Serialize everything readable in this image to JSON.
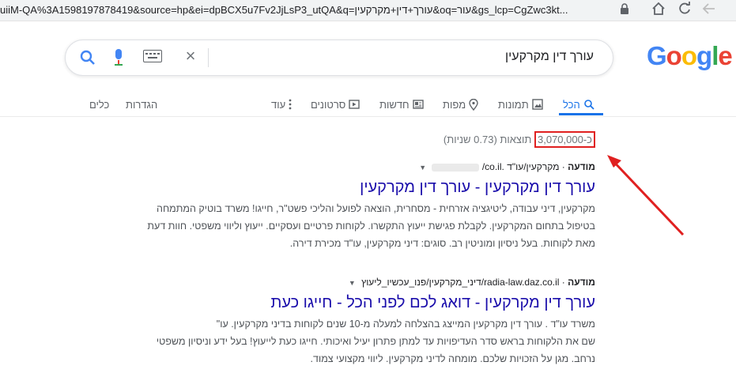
{
  "browser": {
    "url": "uiiM-QA%3A1598197878419&source=hp&ei=dpBCX5u7Fv2JjLsP3_utQA&q=עורך+דין+מקרקעין&oq=עור&gs_lcp=CgZwc3kt...",
    "lock_icon": "lock-icon",
    "nav_icons": [
      "home-icon",
      "reload-icon",
      "back-icon"
    ]
  },
  "search": {
    "query": "עורך דין מקרקעין",
    "clear_icon": "close-icon",
    "keyboard_icon": "keyboard-icon",
    "mic_icon": "mic-icon",
    "search_icon": "search-icon"
  },
  "logo": {
    "letters": [
      "G",
      "o",
      "o",
      "g",
      "l",
      "e"
    ],
    "colors": [
      "#4285f4",
      "#ea4335",
      "#fbbc05",
      "#4285f4",
      "#34a853",
      "#ea4335"
    ]
  },
  "tabs": {
    "all": "הכל",
    "images": "תמונות",
    "maps": "מפות",
    "news": "חדשות",
    "videos": "סרטונים",
    "more": "עוד",
    "settings": "הגדרות",
    "tools": "כלים",
    "accent": "#1a73e8"
  },
  "stats": {
    "prefix": "כ-",
    "count": "3,070,000",
    "suffix": "תוצאות (0.73 שניות)",
    "highlight_color": "#e02020"
  },
  "results": [
    {
      "ad_label": "מודעה",
      "url": "מקרקעין/עו\"ד",
      "domain": ".co.il/",
      "title": "עורך דין מקרקעין - עורך דין מקרקעין",
      "snippet_lines": [
        "מקרקעין, דיני עבודה, ליטיגציה אזרחית - מסחרית, הוצאה לפועל והליכי פשט\"ר, חייגו! משרד בוטיק המתמחה",
        "בטיפול בתחום המקרקעין. לקבלת פגישת ייעוץ התקשרו. לקוחות פרטיים ועסקיים. ייעוץ וליווי משפטי. חוות דעת",
        "מאת לקוחות. בעל ניסיון ומוניטין רב. סוגים: דיני מקרקעין, עו\"ד מכירת דירה."
      ]
    },
    {
      "ad_label": "מודעה",
      "url": "radia-law.daz.co.il/דיני_מקרקעין/פנו_עכשיו_ליעוץ",
      "title": "עורך דין מקרקעין - דואג לכם לפני הכל - חייגו כעת",
      "snippet_lines": [
        "משרד עו\"ד . עורך דין מקרקעין המייצג בהצלחה למעלה מ-10 שנים לקוחות בדיני מקרקעין. עו\"",
        "שם את הלקוחות בראש סדר העדיפויות עד למתן פתרון יעיל ואיכותי. חייגו כעת לייעוץ! בעל ידע וניסיון משפטי",
        "נרחב. מגן על הזכויות שלכם. מומחה לדיני מקרקעין. ליווי מקצועי צמוד."
      ]
    }
  ]
}
